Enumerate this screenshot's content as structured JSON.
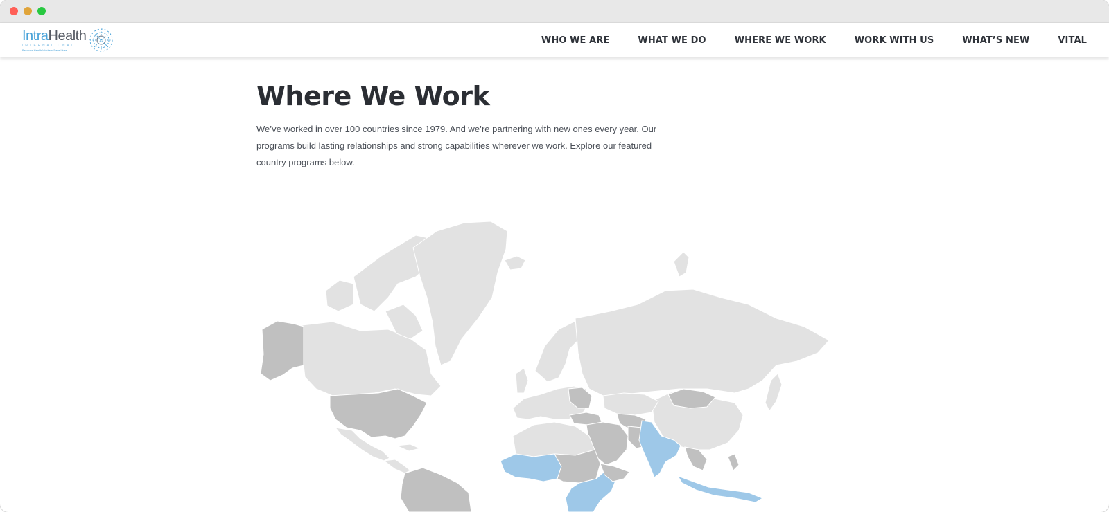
{
  "nav": {
    "logo": {
      "word_a": "Intra",
      "word_b": "Health",
      "sub": "INTERNATIONAL",
      "tagline": "Because Health Workers Save Lives."
    },
    "menu": [
      "WHO WE ARE",
      "WHAT WE DO",
      "WHERE WE WORK",
      "WORK WITH US",
      "WHAT’S NEW",
      "VITAL"
    ]
  },
  "page": {
    "title": "Where We Work",
    "intro": "We’ve worked in over 100 countries since 1979. And we’re partnering with new ones every year. Our programs build lasting relationships and strong capabilities wherever we work. Explore our featured country programs below."
  },
  "map": {
    "colors": {
      "land": "#e2e2e2",
      "worked": "#c0c0c0",
      "featured": "#9ec8e8"
    }
  }
}
